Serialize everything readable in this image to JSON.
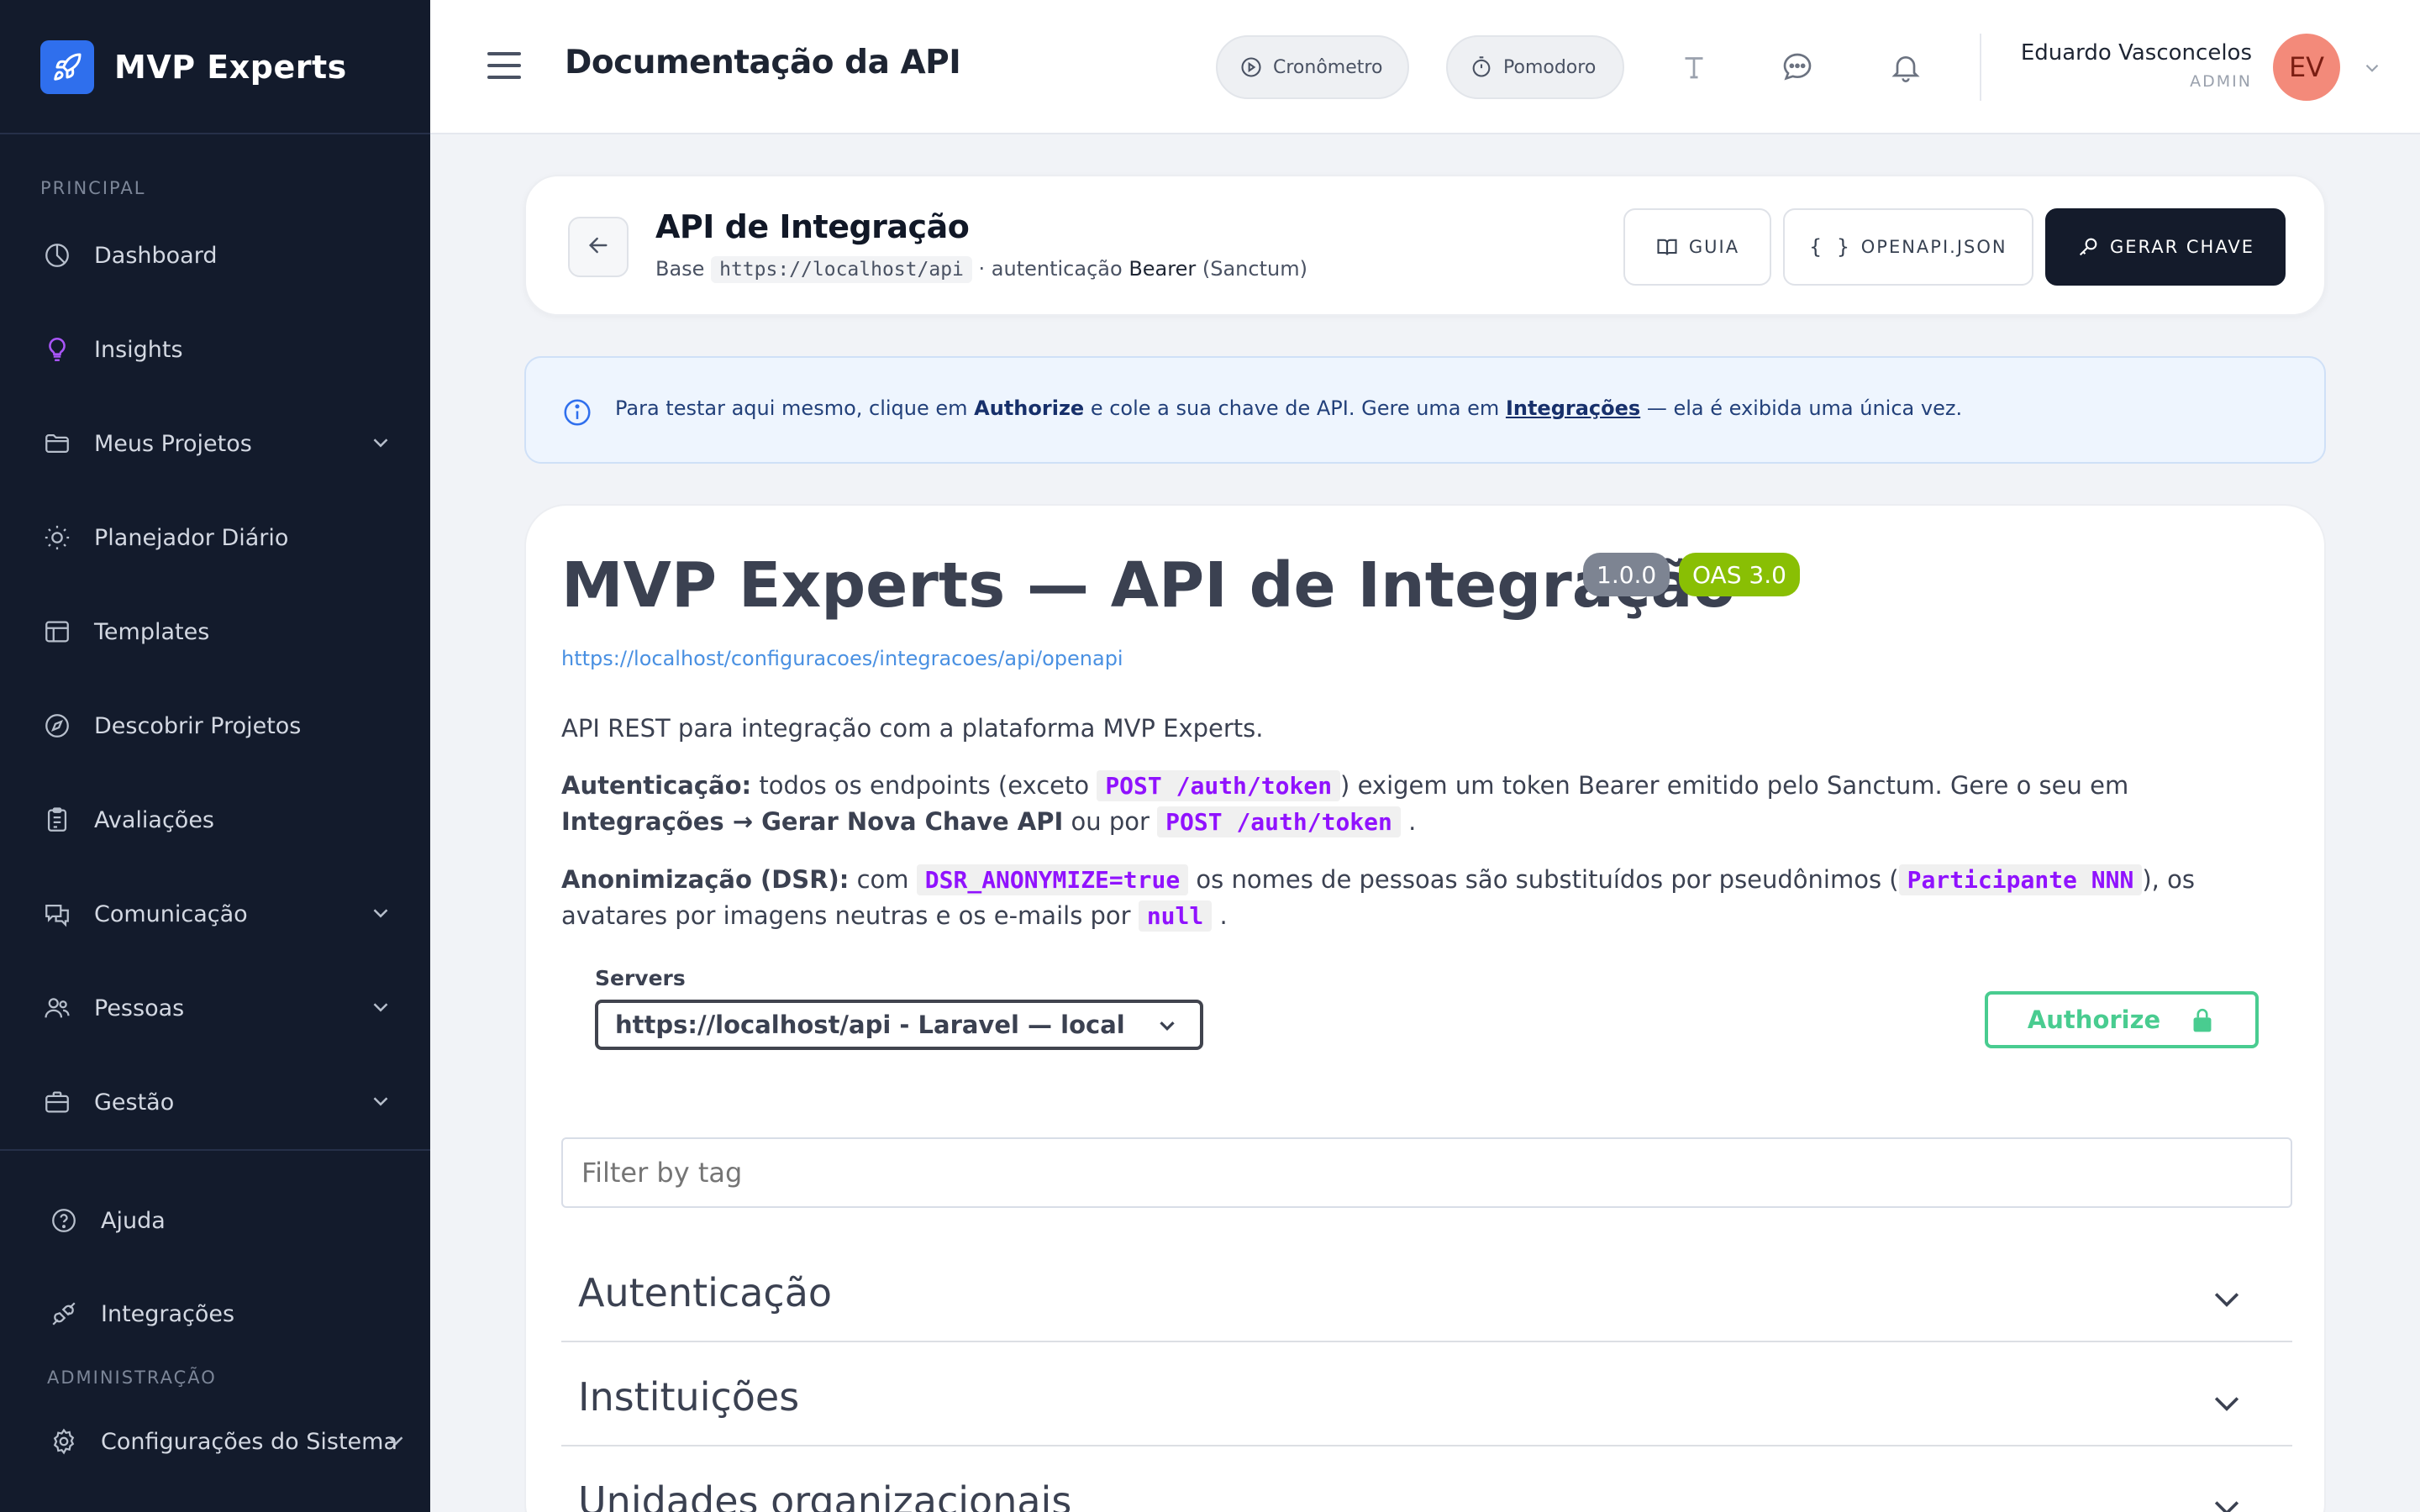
{
  "brand": {
    "name": "MVP Experts",
    "icon": "rocket-icon",
    "accent": "#2f6fed"
  },
  "sidebar": {
    "section_principal": "PRINCIPAL",
    "items": [
      {
        "label": "Dashboard",
        "icon": "pie-chart-icon"
      },
      {
        "label": "Insights",
        "icon": "lightbulb-icon",
        "icon_color": "#a855f7"
      },
      {
        "label": "Meus Projetos",
        "icon": "folder-icon",
        "has_submenu": true
      },
      {
        "label": "Planejador Diário",
        "icon": "sun-icon"
      },
      {
        "label": "Templates",
        "icon": "layout-icon"
      },
      {
        "label": "Descobrir Projetos",
        "icon": "compass-icon"
      },
      {
        "label": "Avaliações",
        "icon": "clipboard-icon"
      },
      {
        "label": "Comunicação",
        "icon": "messages-icon",
        "has_submenu": true
      },
      {
        "label": "Pessoas",
        "icon": "users-icon",
        "has_submenu": true
      },
      {
        "label": "Gestão",
        "icon": "briefcase-icon",
        "has_submenu": true
      }
    ],
    "bottom": [
      {
        "label": "Ajuda",
        "icon": "help-circle-icon"
      },
      {
        "label": "Integrações",
        "icon": "plug-icon"
      }
    ],
    "section_admin": "ADMINISTRAÇÃO",
    "admin_items": [
      {
        "label": "Configurações do Sistema",
        "icon": "settings-icon",
        "has_submenu": true
      }
    ]
  },
  "header": {
    "title": "Documentação da API",
    "cronometro": "Cronômetro",
    "pomodoro": "Pomodoro",
    "user_name": "Eduardo Vasconcelos",
    "user_role": "ADMIN",
    "avatar_initials": "EV",
    "avatar_color": "#f38a7a"
  },
  "hero": {
    "title": "API de Integração",
    "sub_prefix": "Base",
    "base_url": "https://localhost/api",
    "sub_mid": "· autenticação",
    "sub_bearer": "Bearer",
    "sub_suffix": "(Sanctum)",
    "btn_guia": "GUIA",
    "btn_openapi": "OPENAPI.JSON",
    "btn_gerar": "GERAR CHAVE"
  },
  "alert": {
    "part1": "Para testar aqui mesmo, clique em",
    "authorize": "Authorize",
    "part2": "e cole a sua chave de API. Gere uma em",
    "link": "Integrações",
    "part3": "— ela é exibida uma única vez."
  },
  "swagger": {
    "title": "MVP Experts — API de Integração",
    "version": "1.0.0",
    "oas": "OAS 3.0",
    "spec_url": "https://localhost/configuracoes/integracoes/api/openapi",
    "intro": "API REST para integração com a plataforma MVP Experts.",
    "auth_label": "Autenticação:",
    "auth_t1": "todos os endpoints (exceto",
    "auth_code1": "POST /auth/token",
    "auth_t2": ") exigem um token Bearer emitido pelo Sanctum. Gere o seu em",
    "auth_bold": "Integrações → Gerar Nova Chave API",
    "auth_t3": "ou por",
    "auth_code2": "POST /auth/token",
    "auth_t4": ".",
    "anon_label": "Anonimização (DSR):",
    "anon_t1": "com",
    "anon_code1": "DSR_ANONYMIZE=true",
    "anon_t2": "os nomes de pessoas são substituídos por pseudônimos (",
    "anon_code2": "Participante NNN",
    "anon_t3": "), os avatares por imagens neutras e os e-mails por",
    "anon_code3": "null",
    "anon_t4": ".",
    "servers_label": "Servers",
    "server_selected": "https://localhost/api - Laravel — local",
    "authorize_label": "Authorize",
    "filter_placeholder": "Filter by tag",
    "tags": [
      "Autenticação",
      "Instituições",
      "Unidades organizacionais"
    ]
  }
}
